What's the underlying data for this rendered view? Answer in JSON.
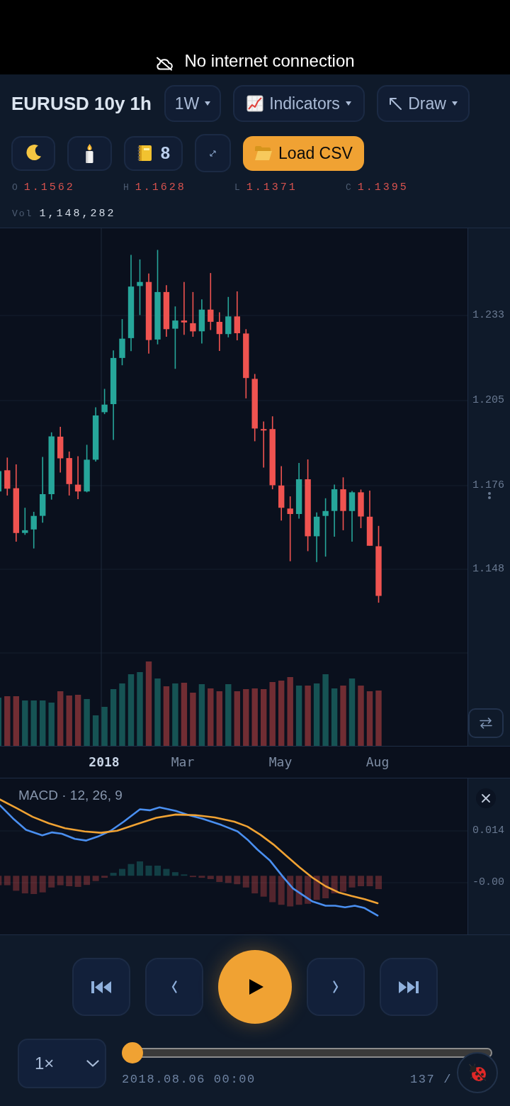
{
  "banner": {
    "text": "No internet connection"
  },
  "header": {
    "title": "EURUSD 10y 1h",
    "menus": [
      {
        "label": "1W"
      },
      {
        "label": "Indicators"
      },
      {
        "label": "Draw"
      }
    ],
    "count_button": {
      "label": "8"
    },
    "load_button": {
      "label": "Load CSV"
    }
  },
  "quote": {
    "ohlc": [
      {
        "label": "O",
        "value": "1.1562"
      },
      {
        "label": "H",
        "value": "1.1628"
      },
      {
        "label": "L",
        "value": "1.1371"
      },
      {
        "label": "C",
        "value": "1.1395"
      }
    ],
    "volume": {
      "label": "Vol",
      "value": "1,148,282"
    }
  },
  "price_chart": {
    "price_axis": [
      "1.233",
      "1.205",
      "1.176",
      "1.148"
    ],
    "time_axis": [
      {
        "label": "2018",
        "major": true
      },
      {
        "label": "Mar",
        "major": false
      },
      {
        "label": "May",
        "major": false
      },
      {
        "label": "Aug",
        "major": false
      }
    ]
  },
  "macd_pane": {
    "title": "MACD · 12, 26, 9",
    "axis": [
      "0.014",
      "-0.00"
    ]
  },
  "playback": {
    "speed": "1×",
    "slider": {
      "level": 0
    },
    "timestamp": "2018.08.06 00:00",
    "counter": "137 /"
  }
}
